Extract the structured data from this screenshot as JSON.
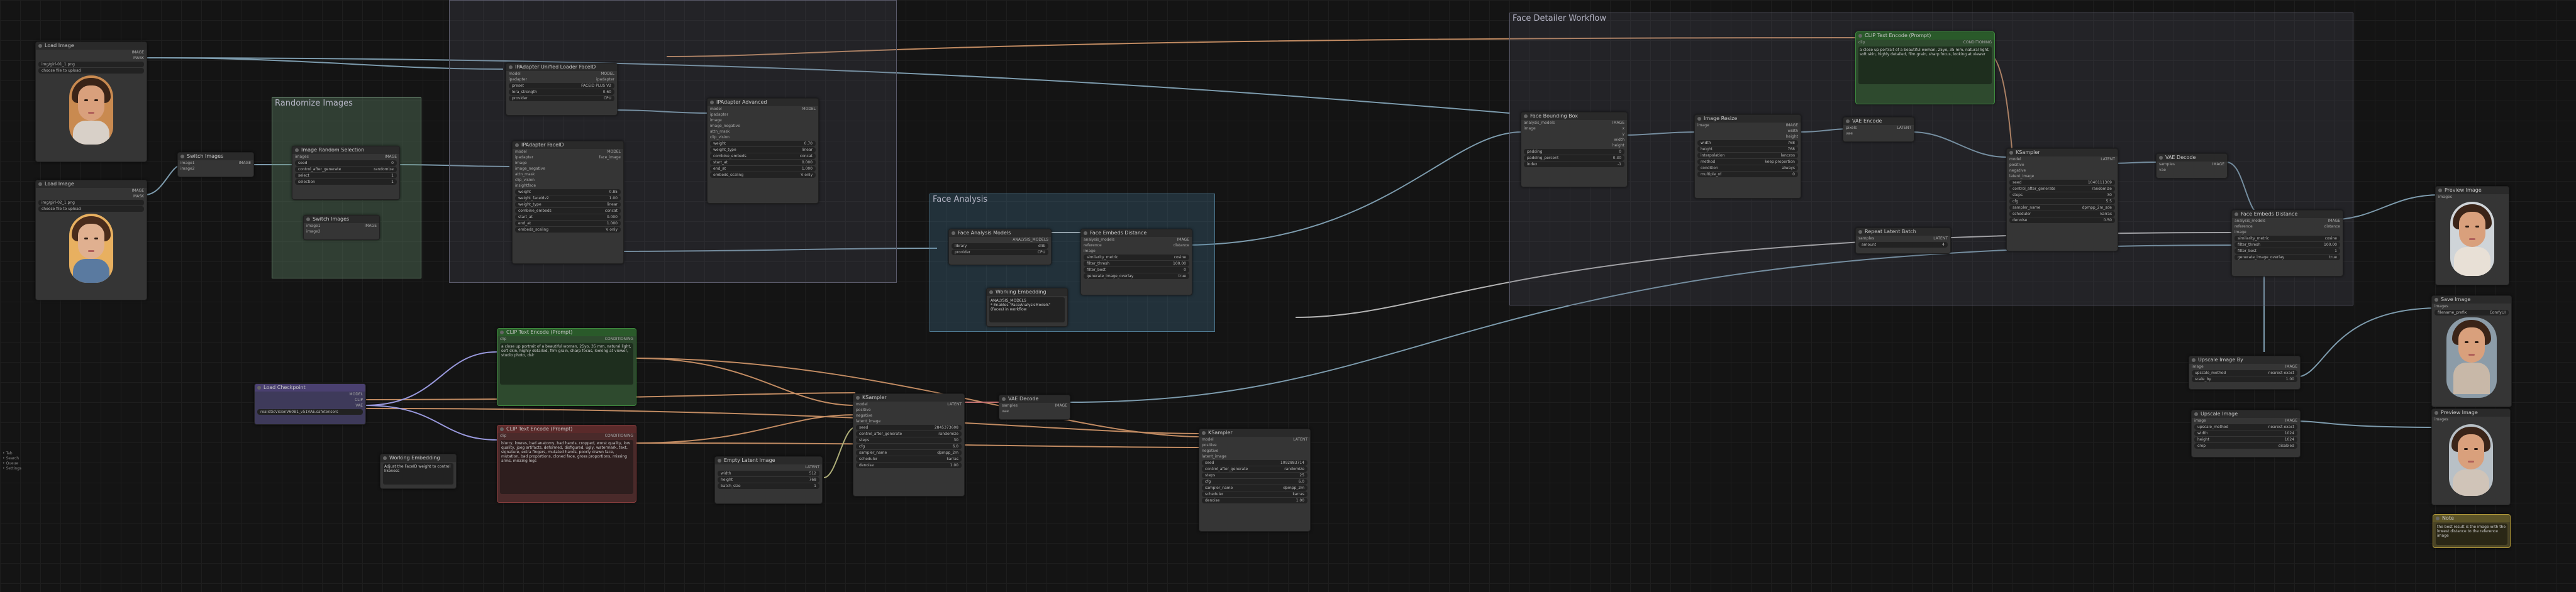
{
  "groups": {
    "randomize": "Randomize Images",
    "face_analysis": "Face Analysis",
    "face_detailer": "Face Detailer Workflow"
  },
  "load_image_1": {
    "title": "Load Image",
    "out1": "IMAGE",
    "out2": "MASK",
    "file": "image",
    "file_value": "img/girl-01_1.png",
    "upload": "choose file to upload"
  },
  "load_image_2": {
    "title": "Load Image",
    "out1": "IMAGE",
    "out2": "MASK",
    "file": "image",
    "file_value": "img/girl-02_1.png",
    "upload": "choose file to upload"
  },
  "switch_images": {
    "title": "Switch Images",
    "in1": "image1",
    "in2": "image2",
    "out": "IMAGE"
  },
  "random_selector": {
    "title": "Image Random Selection",
    "in": "images",
    "out": "IMAGE",
    "w1_label": "seed",
    "w1_val": "0",
    "w2_label": "control_after_generate",
    "w2_val": "randomize",
    "w3_label": "select",
    "w3_val": "1",
    "w4_label": "selection",
    "w4_val": "1"
  },
  "switch_images_2": {
    "title": "Switch Images",
    "in1": "image1",
    "in2": "image2",
    "out": "IMAGE"
  },
  "unified_loader": {
    "title": "IPAdapter Unified Loader FaceID",
    "in1": "model",
    "in2": "ipadapter",
    "out1": "MODEL",
    "out2": "ipadapter",
    "w1_label": "preset",
    "w1_val": "FACEID PLUS V2",
    "w2_label": "lora_strength",
    "w2_val": "0.60",
    "w3_label": "provider",
    "w3_val": "CPU"
  },
  "ipadapter_faceid": {
    "title": "IPAdapter FaceID",
    "in1": "model",
    "in2": "ipadapter",
    "in3": "image",
    "in4": "image_negative",
    "in5": "attn_mask",
    "in6": "clip_vision",
    "in7": "insightface",
    "out1": "MODEL",
    "out2": "face_image",
    "w1_label": "weight",
    "w1_val": "0.85",
    "w2_label": "weight_faceidv2",
    "w2_val": "1.00",
    "w3_label": "weight_type",
    "w3_val": "linear",
    "w4_label": "combine_embeds",
    "w4_val": "concat",
    "w5_label": "start_at",
    "w5_val": "0.000",
    "w6_label": "end_at",
    "w6_val": "1.000",
    "w7_label": "embeds_scaling",
    "w7_val": "V only"
  },
  "ipadapter_adv": {
    "title": "IPAdapter Advanced",
    "in1": "model",
    "in2": "ipadapter",
    "in3": "image",
    "in4": "image_negative",
    "in5": "attn_mask",
    "in6": "clip_vision",
    "out": "MODEL",
    "w1_label": "weight",
    "w1_val": "0.70",
    "w2_label": "weight_type",
    "w2_val": "linear",
    "w3_label": "combine_embeds",
    "w3_val": "concat",
    "w4_label": "start_at",
    "w4_val": "0.000",
    "w5_label": "end_at",
    "w5_val": "1.000",
    "w6_label": "embeds_scaling",
    "w6_val": "V only"
  },
  "checkpoint": {
    "title": "Load Checkpoint",
    "out1": "MODEL",
    "out2": "CLIP",
    "out3": "VAE",
    "w1_label": "ckpt_name",
    "w1_val": "realisticVisionV60B1_v51VAE.safetensors"
  },
  "clip_pos": {
    "title": "CLIP Text Encode (Prompt)",
    "in": "clip",
    "out": "CONDITIONING",
    "text": "a close up portrait of a beautiful woman, 25yo, 35 mm, natural light, soft skin, highly detailed, film grain, sharp focus, looking at viewer, studio photo, dslr"
  },
  "clip_neg": {
    "title": "CLIP Text Encode (Prompt)",
    "in": "clip",
    "out": "CONDITIONING",
    "text": "blurry, lowres, bad anatomy, bad hands, cropped, worst quality, low quality, jpeg artifacts, deformed, disfigured, ugly, watermark, text, signature, extra fingers, mutated hands, poorly drawn face, mutation, bad proportions, cloned face, gross proportions, missing arms, missing legs"
  },
  "empty_latent": {
    "title": "Empty Latent Image",
    "out": "LATENT",
    "w1_label": "width",
    "w1_val": "512",
    "w2_label": "height",
    "w2_val": "768",
    "w3_label": "batch_size",
    "w3_val": "1"
  },
  "working_1": {
    "title": "Working Embedding",
    "text": "Adjust the FaceID weight to control likeness"
  },
  "ksampler_1": {
    "title": "KSampler",
    "in1": "model",
    "in2": "positive",
    "in3": "negative",
    "in4": "latent_image",
    "out": "LATENT",
    "w1_label": "seed",
    "w1_val": "2845373608",
    "w2_label": "control_after_generate",
    "w2_val": "randomize",
    "w3_label": "steps",
    "w3_val": "30",
    "w4_label": "cfg",
    "w4_val": "6.0",
    "w5_label": "sampler_name",
    "w5_val": "dpmpp_2m",
    "w6_label": "scheduler",
    "w6_val": "karras",
    "w7_label": "denoise",
    "w7_val": "1.00"
  },
  "vae_decode_1": {
    "title": "VAE Decode",
    "in1": "samples",
    "in2": "vae",
    "out": "IMAGE"
  },
  "ksampler_2": {
    "title": "KSampler",
    "in1": "model",
    "in2": "positive",
    "in3": "negative",
    "in4": "latent_image",
    "out": "LATENT",
    "w1_label": "seed",
    "w1_val": "1092883714",
    "w2_label": "control_after_generate",
    "w2_val": "randomize",
    "w3_label": "steps",
    "w3_val": "25",
    "w4_label": "cfg",
    "w4_val": "6.0",
    "w5_label": "sampler_name",
    "w5_val": "dpmpp_2m",
    "w6_label": "scheduler",
    "w6_val": "karras",
    "w7_label": "denoise",
    "w7_val": "1.00"
  },
  "face_models": {
    "title": "Face Analysis Models",
    "out": "ANALYSIS_MODELS",
    "w1_label": "library",
    "w1_val": "dlib",
    "w2_label": "provider",
    "w2_val": "CPU"
  },
  "face_embeds_dist": {
    "title": "Face Embeds Distance",
    "in1": "analysis_models",
    "in2": "reference",
    "in3": "image",
    "out1": "IMAGE",
    "out2": "distance",
    "w1_label": "similarity_metric",
    "w1_val": "cosine",
    "w2_label": "filter_thresh",
    "w2_val": "100.00",
    "w3_label": "filter_best",
    "w3_val": "0",
    "w4_label": "generate_image_overlay",
    "w4_val": "true"
  },
  "working_2": {
    "title": "Working Embedding",
    "text": "ANALYSIS_MODELS\n* Enables \"FaceAnalysisModels\" (Faces) in workflow"
  },
  "bbox_det": {
    "title": "Face Bounding Box",
    "in1": "analysis_models",
    "in2": "image",
    "out1": "IMAGE",
    "out2": "x",
    "out3": "y",
    "out4": "width",
    "out5": "height",
    "w1_label": "padding",
    "w1_val": "0",
    "w2_label": "padding_percent",
    "w2_val": "0.30",
    "w3_label": "index",
    "w3_val": "-1"
  },
  "image_resize": {
    "title": "Image Resize",
    "in": "image",
    "out1": "IMAGE",
    "out2": "width",
    "out3": "height",
    "w1_label": "width",
    "w1_val": "768",
    "w2_label": "height",
    "w2_val": "768",
    "w3_label": "interpolation",
    "w3_val": "lanczos",
    "w4_label": "method",
    "w4_val": "keep proportion",
    "w5_label": "condition",
    "w5_val": "always",
    "w6_label": "multiple_of",
    "w6_val": "0"
  },
  "vae_encode": {
    "title": "VAE Encode",
    "in1": "pixels",
    "in2": "vae",
    "out": "LATENT"
  },
  "clip_face": {
    "title": "CLIP Text Encode (Prompt)",
    "in": "clip",
    "out": "CONDITIONING",
    "text": "a close up portrait of a beautiful woman, 25yo, 35 mm, natural light, soft skin, highly detailed, film grain, sharp focus, looking at viewer"
  },
  "repeat_latent": {
    "title": "Repeat Latent Batch",
    "in": "samples",
    "out": "LATENT",
    "w1_label": "amount",
    "w1_val": "4"
  },
  "ksampler_3": {
    "title": "KSampler",
    "in1": "model",
    "in2": "positive",
    "in3": "negative",
    "in4": "latent_image",
    "out": "LATENT",
    "w1_label": "seed",
    "w1_val": "1040111309",
    "w2_label": "control_after_generate",
    "w2_val": "randomize",
    "w3_label": "steps",
    "w3_val": "30",
    "w4_label": "cfg",
    "w4_val": "5.5",
    "w5_label": "sampler_name",
    "w5_val": "dpmpp_2m_sde",
    "w6_label": "scheduler",
    "w6_val": "karras",
    "w7_label": "denoise",
    "w7_val": "0.50"
  },
  "vae_decode_2": {
    "title": "VAE Decode",
    "in1": "samples",
    "in2": "vae",
    "out": "IMAGE"
  },
  "face_embeds_dist_2": {
    "title": "Face Embeds Distance",
    "in1": "analysis_models",
    "in2": "reference",
    "in3": "image",
    "out1": "IMAGE",
    "out2": "distance",
    "w1_label": "similarity_metric",
    "w1_val": "cosine",
    "w2_label": "filter_thresh",
    "w2_val": "100.00",
    "w3_label": "filter_best",
    "w3_val": "1",
    "w4_label": "generate_image_overlay",
    "w4_val": "true"
  },
  "preview_1": {
    "title": "Preview Image",
    "in": "images"
  },
  "save_image": {
    "title": "Save Image",
    "in": "images",
    "w1_label": "filename_prefix",
    "w1_val": "ComfyUI"
  },
  "upscale_by": {
    "title": "Upscale Image By",
    "in": "image",
    "out": "IMAGE",
    "w1_label": "upscale_method",
    "w1_val": "nearest-exact",
    "w2_label": "scale_by",
    "w2_val": "1.00"
  },
  "upscale_img": {
    "title": "Upscale Image",
    "in": "image",
    "out": "IMAGE",
    "w1_label": "upscale_method",
    "w1_val": "nearest-exact",
    "w2_label": "width",
    "w2_val": "1024",
    "w3_label": "height",
    "w3_val": "1024",
    "w4_label": "crop",
    "w4_val": "disabled"
  },
  "preview_2": {
    "title": "Preview Image",
    "in": "images"
  },
  "note": {
    "title": "Note",
    "text": "the best result is the image with the lowest distance to the reference image"
  },
  "side_note": {
    "text": "• Tab\n• Search\n• Queue\n• Settings"
  }
}
